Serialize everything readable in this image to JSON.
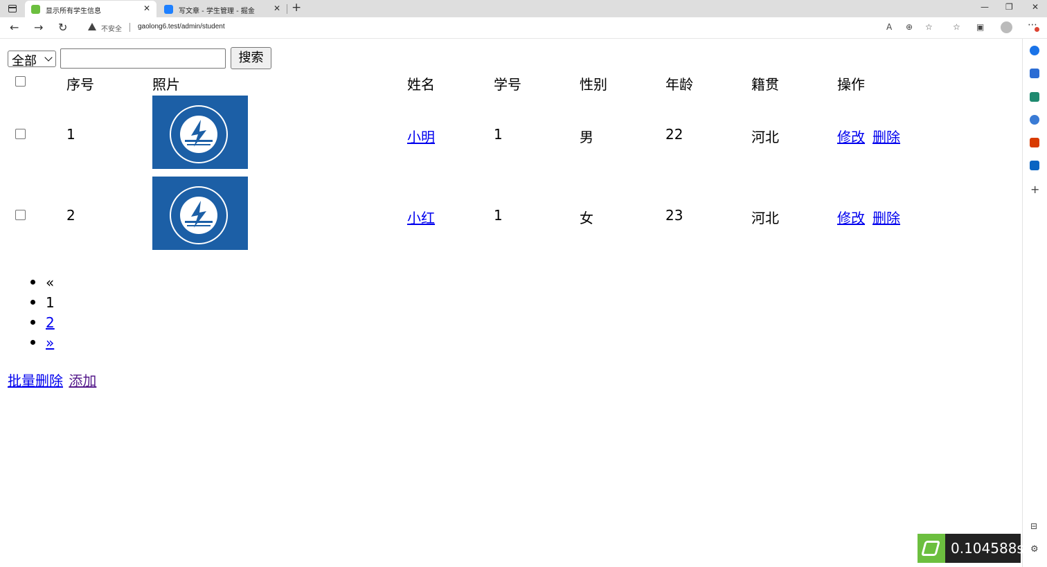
{
  "browser": {
    "tabs": [
      {
        "title": "显示所有学生信息",
        "active": true,
        "favicon_color": "#6cbf3f"
      },
      {
        "title": "写文章 - 学生管理 - 掘金",
        "active": false,
        "favicon_color": "#1e80ff"
      }
    ],
    "close_glyph": "✕",
    "new_tab_glyph": "+",
    "window_controls": [
      "—",
      "❐",
      "✕"
    ],
    "nav": {
      "back": "←",
      "forward": "→",
      "reload": "↻"
    },
    "insecure_label": "不安全",
    "url": "gaolong6.test/admin/student",
    "menu_glyph": "⋯"
  },
  "filter": {
    "selected": "全部",
    "search_value": "",
    "search_button": "搜索"
  },
  "table": {
    "headers": {
      "id": "序号",
      "photo": "照片",
      "name": "姓名",
      "student_no": "学号",
      "gender": "性别",
      "age": "年龄",
      "hometown": "籍贯",
      "actions": "操作"
    },
    "rows": [
      {
        "id": "1",
        "name": "小明",
        "student_no": "1",
        "gender": "男",
        "age": "22",
        "hometown": "河北",
        "edit": "修改",
        "delete": "删除"
      },
      {
        "id": "2",
        "name": "小红",
        "student_no": "1",
        "gender": "女",
        "age": "23",
        "hometown": "河北",
        "edit": "修改",
        "delete": "删除"
      }
    ]
  },
  "pagination": [
    "«",
    "1",
    "2",
    "»"
  ],
  "bottom": {
    "batch_delete": "批量删除",
    "add": "添加"
  },
  "timer": "0.104588s",
  "colors": {
    "photo_bg": "#1c5fa6",
    "link": "#0000ee",
    "visited_link": "#551a8b"
  }
}
